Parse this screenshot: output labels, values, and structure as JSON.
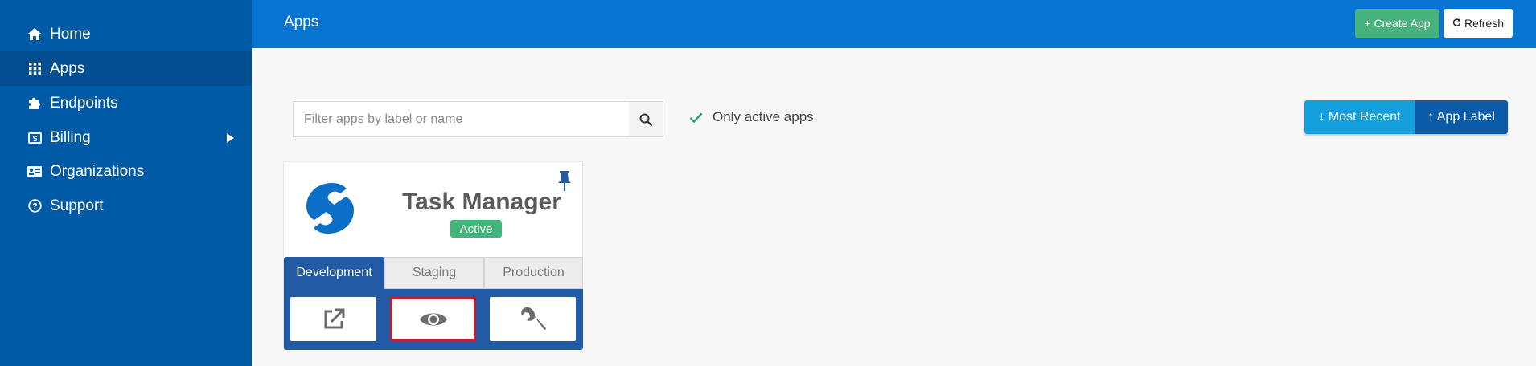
{
  "sidebar": {
    "items": [
      {
        "label": "Home",
        "icon": "home-icon"
      },
      {
        "label": "Apps",
        "icon": "grid-icon",
        "active": true
      },
      {
        "label": "Endpoints",
        "icon": "puzzle-icon"
      },
      {
        "label": "Billing",
        "icon": "dollar-icon",
        "has_submenu": true
      },
      {
        "label": "Organizations",
        "icon": "id-card-icon"
      },
      {
        "label": "Support",
        "icon": "help-icon"
      }
    ]
  },
  "header": {
    "title": "Apps",
    "create_label": "+ Create App",
    "refresh_label": "Refresh"
  },
  "filter": {
    "placeholder": "Filter apps by label or name",
    "value": "",
    "active_only_label": "Only active apps",
    "active_only_checked": true
  },
  "sort": {
    "recent_label": "↓ Most Recent",
    "label_label": "↑ App Label"
  },
  "card": {
    "title": "Task Manager",
    "status": "Active",
    "tabs": [
      "Development",
      "Staging",
      "Production"
    ],
    "selected_tab": "Development",
    "actions": [
      "open-external-icon",
      "eye-icon",
      "wrench-icon"
    ]
  },
  "colors": {
    "sidebar": "#015aa5",
    "topbar": "#0774d2",
    "success": "#46b37c",
    "primary_dark": "#225aa6",
    "highlight": "#c71b2a"
  }
}
